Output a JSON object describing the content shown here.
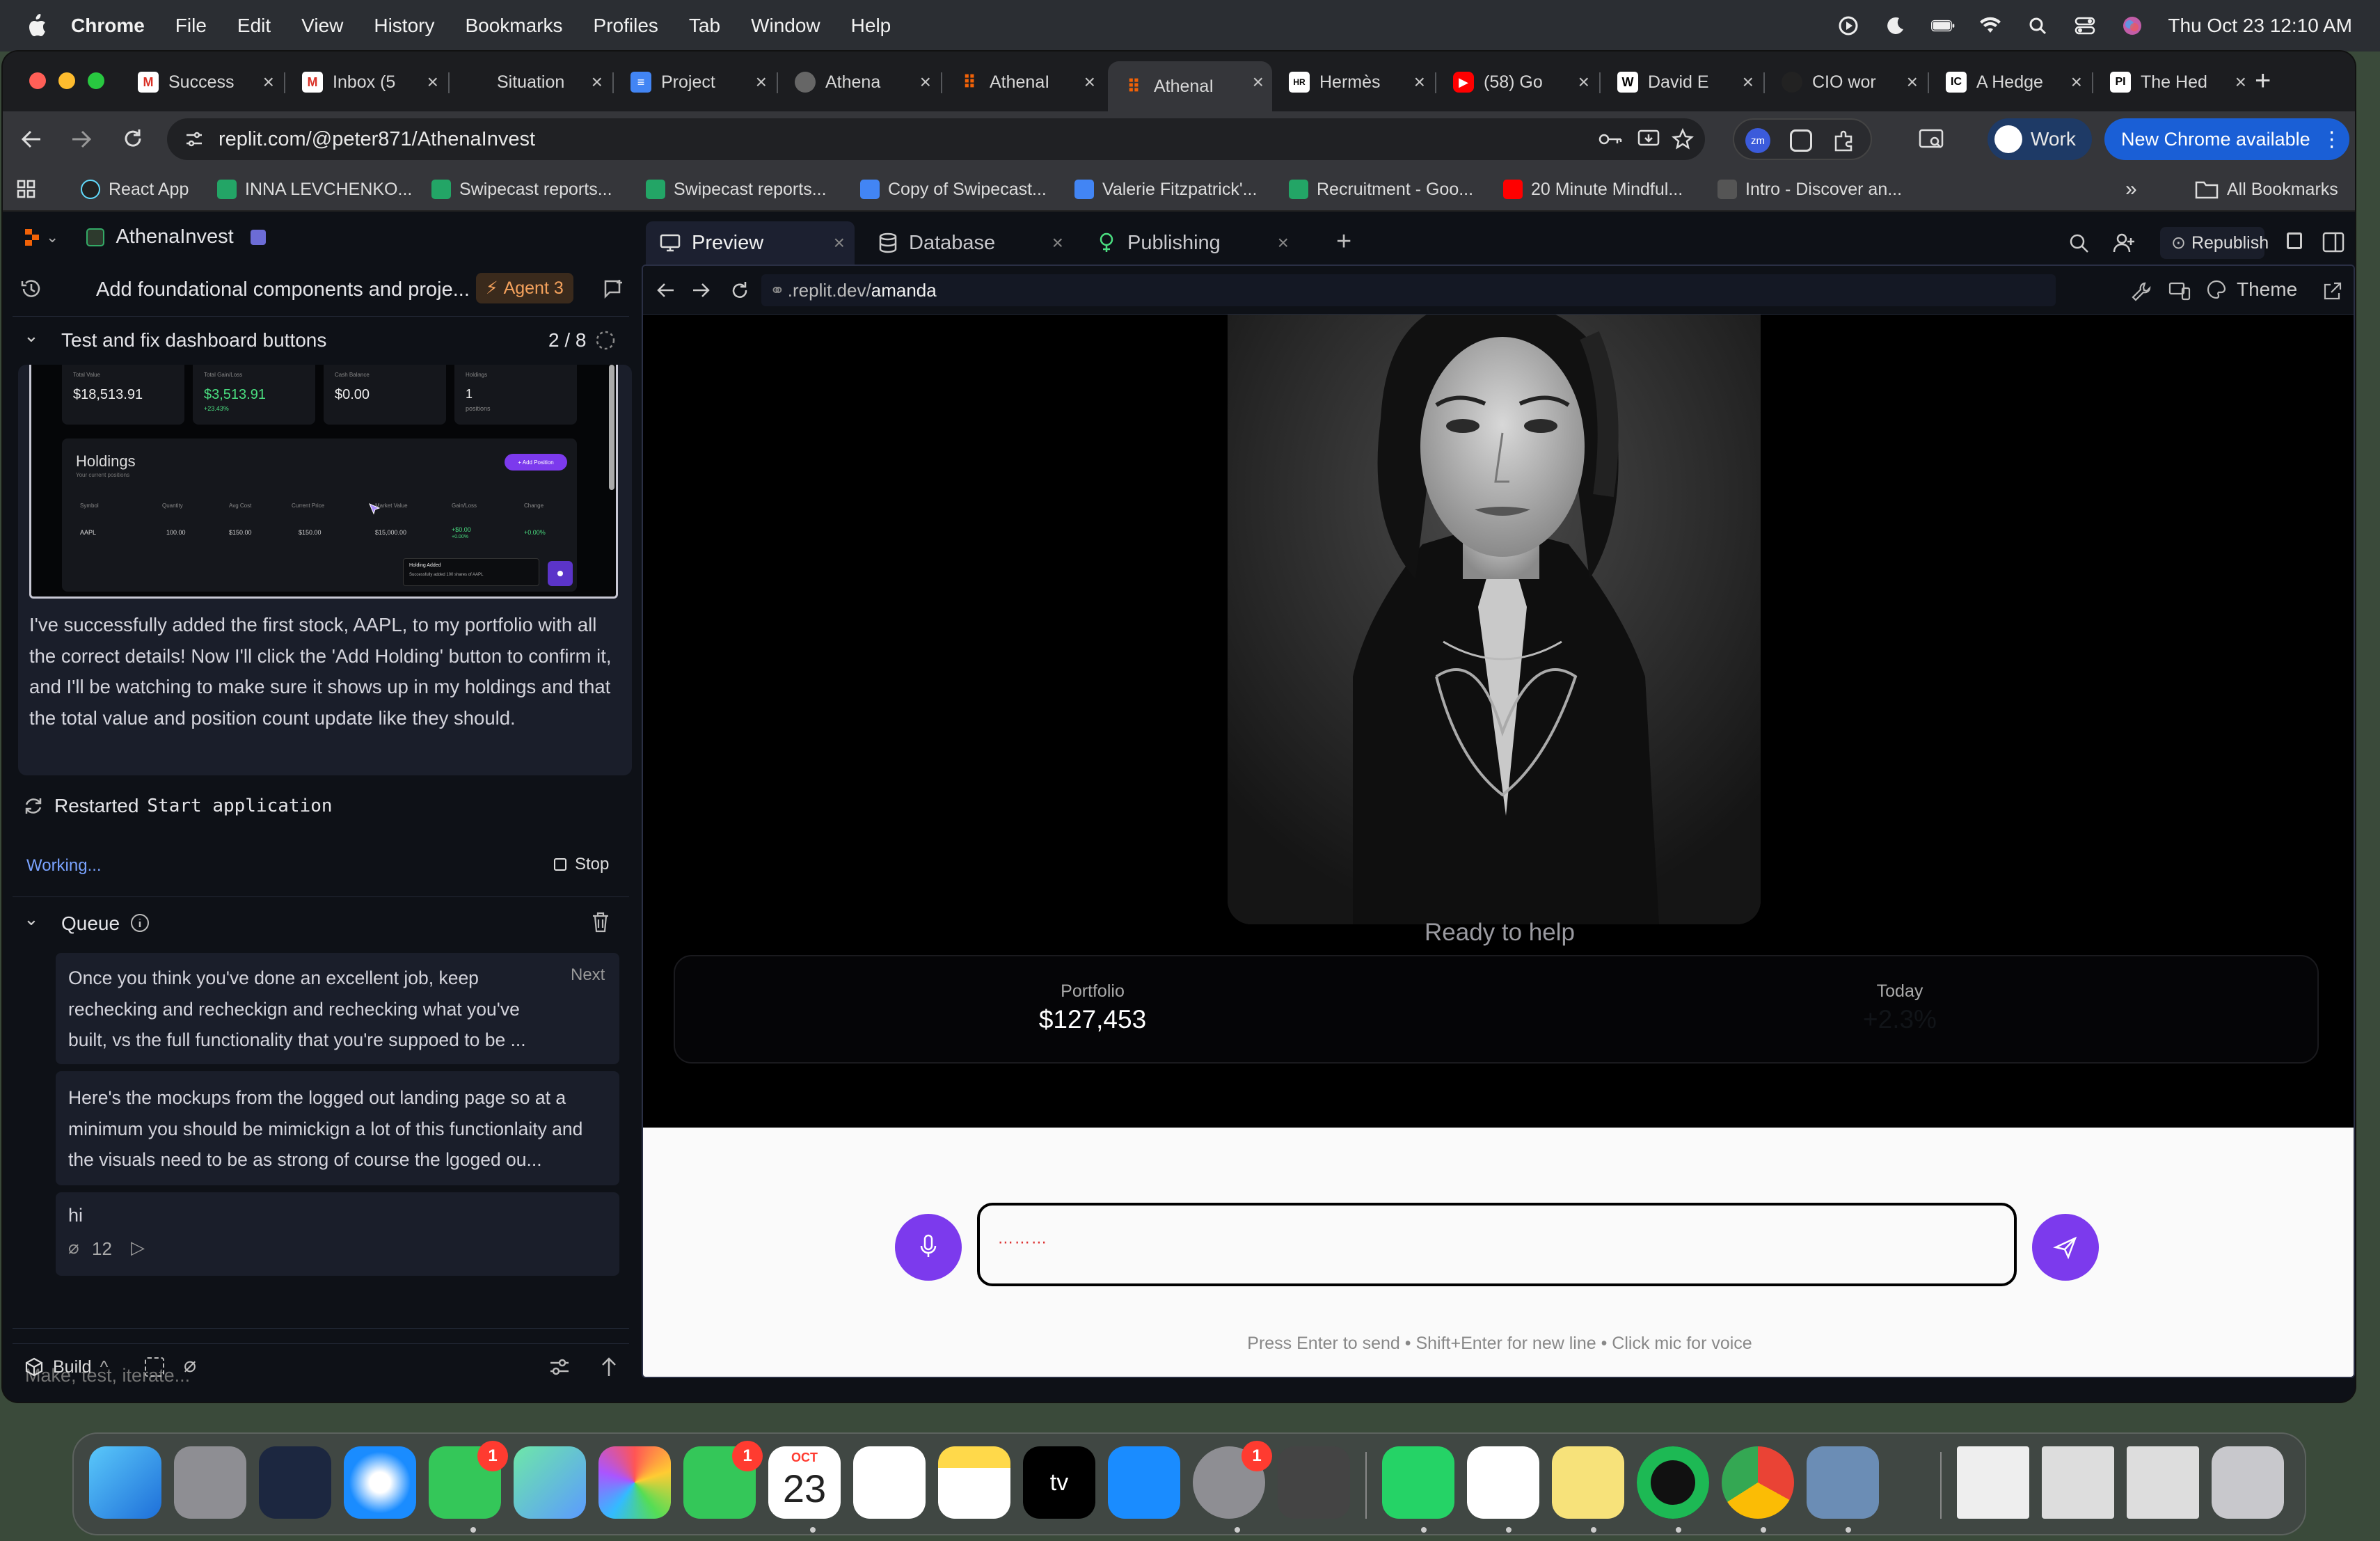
{
  "menubar": {
    "app": "Chrome",
    "items": [
      "File",
      "Edit",
      "View",
      "History",
      "Bookmarks",
      "Profiles",
      "Tab",
      "Window",
      "Help"
    ],
    "datetime": "Thu Oct 23  12:10 AM"
  },
  "tabs": [
    {
      "title": "Success",
      "icon": "gmail-icon"
    },
    {
      "title": "Inbox (5",
      "icon": "gmail-icon"
    },
    {
      "title": "Situation",
      "icon": "doc-icon"
    },
    {
      "title": "Project",
      "icon": "google-docs-icon"
    },
    {
      "title": "Athena",
      "icon": "globe-icon"
    },
    {
      "title": "AthenaI",
      "icon": "replit-icon"
    },
    {
      "title": "AthenaI",
      "icon": "replit-icon",
      "active": true
    },
    {
      "title": "Hermès",
      "icon": "hermes-icon"
    },
    {
      "title": "(58) Go",
      "icon": "youtube-icon"
    },
    {
      "title": "David E",
      "icon": "wikipedia-icon"
    },
    {
      "title": "CIO wor",
      "icon": "openai-icon"
    },
    {
      "title": "A Hedge",
      "icon": "ic-icon"
    },
    {
      "title": "The Hed",
      "icon": "pi-icon"
    }
  ],
  "toolbar": {
    "url": "replit.com/@peter871/AthenaInvest",
    "profile": "Work",
    "update_button": "New Chrome available"
  },
  "bookmarks": [
    {
      "label": "React App"
    },
    {
      "label": "INNA LEVCHENKO..."
    },
    {
      "label": "Swipecast reports..."
    },
    {
      "label": "Swipecast reports..."
    },
    {
      "label": "Copy of Swipecast..."
    },
    {
      "label": "Valerie Fitzpatrick'..."
    },
    {
      "label": "Recruitment - Goo..."
    },
    {
      "label": "20 Minute Mindful..."
    },
    {
      "label": "Intro - Discover an..."
    }
  ],
  "all_bookmarks": "All Bookmarks",
  "replit": {
    "project_name": "AthenaInvest",
    "thread_title": "Add foundational components and proje...",
    "agent_badge": "Agent 3",
    "task": {
      "title": "Test and fix dashboard buttons",
      "progress": "2 / 8"
    },
    "screenshot": {
      "stats": [
        {
          "label": "Total Value",
          "value": "$18,513.91",
          "sub": ""
        },
        {
          "label": "Total Gain/Loss",
          "value": "$3,513.91",
          "sub": "+23.43%"
        },
        {
          "label": "Cash Balance",
          "value": "$0.00",
          "sub": ""
        },
        {
          "label": "Holdings",
          "value": "1",
          "sub": "positions"
        }
      ],
      "holdings_title": "Holdings",
      "holdings_sub": "Your current positions",
      "add_button": "+ Add Position",
      "columns": [
        "Symbol",
        "Quantity",
        "Avg Cost",
        "Current Price",
        "Market Value",
        "Gain/Loss",
        "Change"
      ],
      "row": [
        "AAPL",
        "100.00",
        "$150.00",
        "$150.00",
        "$15,000.00",
        "+$0.00",
        "+0.00%"
      ],
      "row_sub": "+0.00%",
      "toast_title": "Holding Added",
      "toast_body": "Successfully added 100 shares of AAPL"
    },
    "agent_message": "I've successfully added the first stock, AAPL, to my portfolio with all the correct details! Now I'll click the 'Add Holding' button to confirm it, and I'll be watching to make sure it shows up in my holdings and that the total value and position count update like they should.",
    "restarted_prefix": "Restarted",
    "restarted_code": "Start application",
    "working": "Working...",
    "stop": "Stop",
    "queue_title": "Queue",
    "queue": [
      {
        "text": "Once you think you've done an excellent job, keep rechecking and recheckign and rechecking what you've built, vs the full functionality that you're suppoed to be ...",
        "tag": "Next"
      },
      {
        "text": "Here's the mockups from the logged out landing page so at a minimum you should be mimickign a lot of this functionlaity and the visuals need to be as strong of course the lgoged ou...",
        "tag": ""
      },
      {
        "text": "hi",
        "tag": "",
        "attachments": "12"
      }
    ],
    "input_placeholder": "Make, test, iterate...",
    "build_label": "Build",
    "preview_tabs": [
      {
        "label": "Preview",
        "icon": "monitor-icon"
      },
      {
        "label": "Database",
        "icon": "database-icon"
      },
      {
        "label": "Publishing",
        "icon": "publish-icon"
      }
    ],
    "republish": "Republish",
    "preview_url_prefix": ".replit.dev/",
    "preview_url_path": "amanda",
    "theme": "Theme"
  },
  "app_preview": {
    "status": "Ready to help",
    "portfolio_label": "Portfolio",
    "portfolio_value": "$127,453",
    "today_label": "Today",
    "today_value": "+2.3%",
    "hint": "Press Enter to send • Shift+Enter for new line • Click mic for voice"
  },
  "dock": {
    "calendar_month": "OCT",
    "calendar_day": "23",
    "messages_badge": "1",
    "facetime_badge": "1",
    "settings_badge": "1"
  },
  "colors": {
    "accent_purple": "#7c3aed",
    "replit_bg": "#0e1117",
    "chrome_blue": "#1a5fd6",
    "agent_orange": "#f5a25d"
  }
}
